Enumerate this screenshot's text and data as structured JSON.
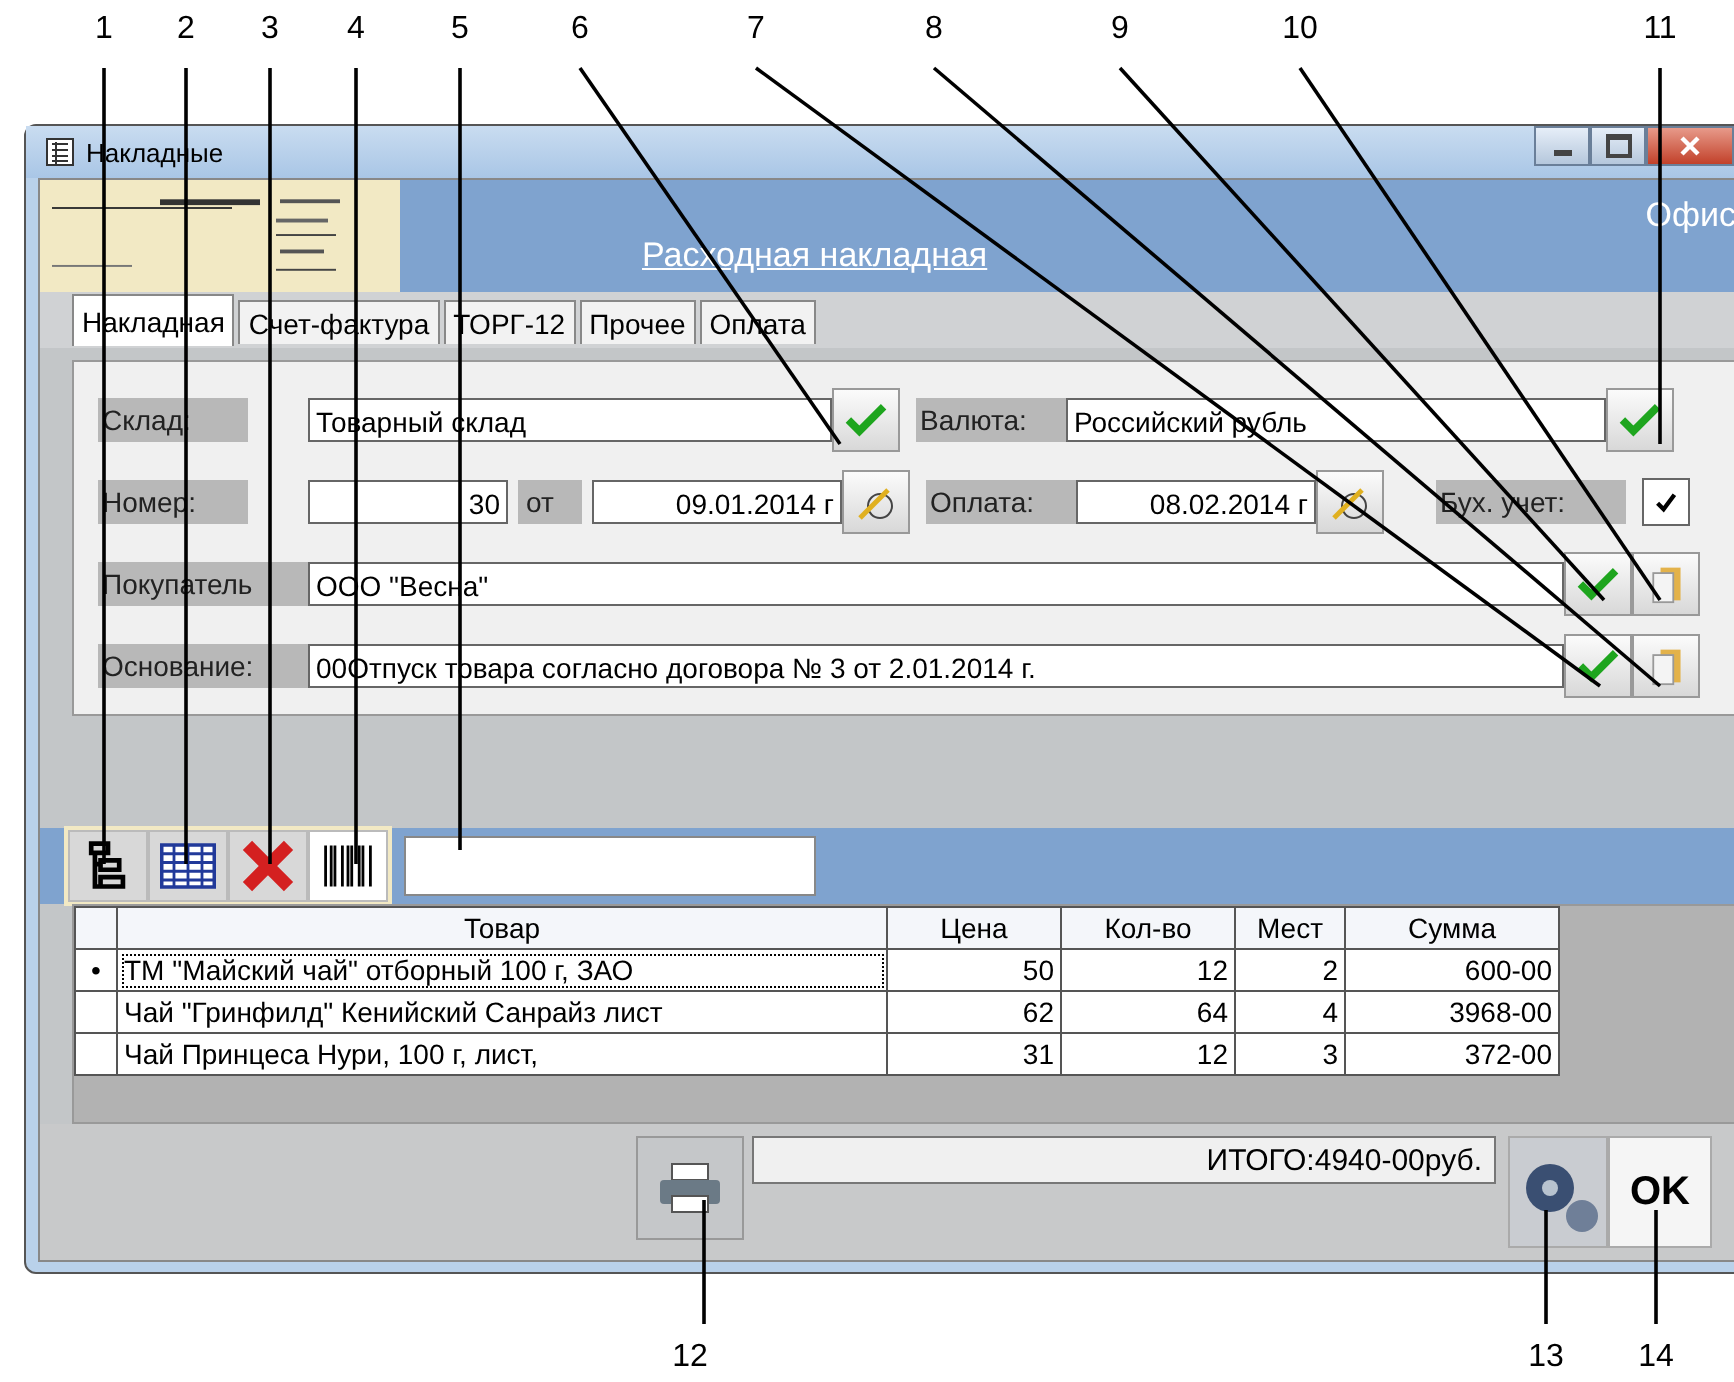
{
  "callouts": [
    {
      "label": "1"
    },
    {
      "label": "2"
    },
    {
      "label": "3"
    },
    {
      "label": "4"
    },
    {
      "label": "5"
    },
    {
      "label": "6"
    },
    {
      "label": "7"
    },
    {
      "label": "8"
    },
    {
      "label": "9"
    },
    {
      "label": "10"
    },
    {
      "label": "11"
    },
    {
      "label": "12"
    },
    {
      "label": "13"
    },
    {
      "label": "14"
    }
  ],
  "window": {
    "title": "Накладные"
  },
  "banner": {
    "title": "Расходная накладная",
    "corner_text": "Офис"
  },
  "tabs": [
    {
      "label": "Накладная",
      "selected": true
    },
    {
      "label": "Счет-фактура",
      "selected": false
    },
    {
      "label": "ТОРГ-12",
      "selected": false
    },
    {
      "label": "Прочее",
      "selected": false
    },
    {
      "label": "Оплата",
      "selected": false
    }
  ],
  "form": {
    "warehouse": {
      "label": "Склад:",
      "value": "Товарный склад"
    },
    "currency": {
      "label": "Валюта:",
      "value": "Российский рубль"
    },
    "number": {
      "label": "Номер:",
      "value": "30"
    },
    "date": {
      "label": "от",
      "value": "09.01.2014 г"
    },
    "payment": {
      "label": "Оплата:",
      "value": "08.02.2014 г"
    },
    "accounting": {
      "label": "Бух. учет:",
      "checked": true
    },
    "buyer": {
      "label": "Покупатель",
      "value": "ООО \"Весна\""
    },
    "basis": {
      "label": "Основание:",
      "value": "00Отпуск товара согласно договора № 3 от 2.01.2014 г."
    }
  },
  "table": {
    "columns": [
      "Товар",
      "Цена",
      "Кол-во",
      "Мест",
      "Сумма"
    ],
    "rows": [
      {
        "selected": true,
        "marker": "•",
        "cells": [
          "ТМ \"Майский чай\" отборный 100 г, ЗАО",
          "50",
          "12",
          "2",
          "600-00"
        ]
      },
      {
        "selected": false,
        "cells": [
          "Чай \"Гринфилд\" Кенийский Санрайз лист",
          "62",
          "64",
          "4",
          "3968-00"
        ]
      },
      {
        "selected": false,
        "cells": [
          "Чай Принцеса Нури, 100 г, лист,",
          "31",
          "12",
          "3",
          "372-00"
        ]
      }
    ]
  },
  "total": "ИТОГО:4940-00руб.",
  "ok_button": "OK"
}
